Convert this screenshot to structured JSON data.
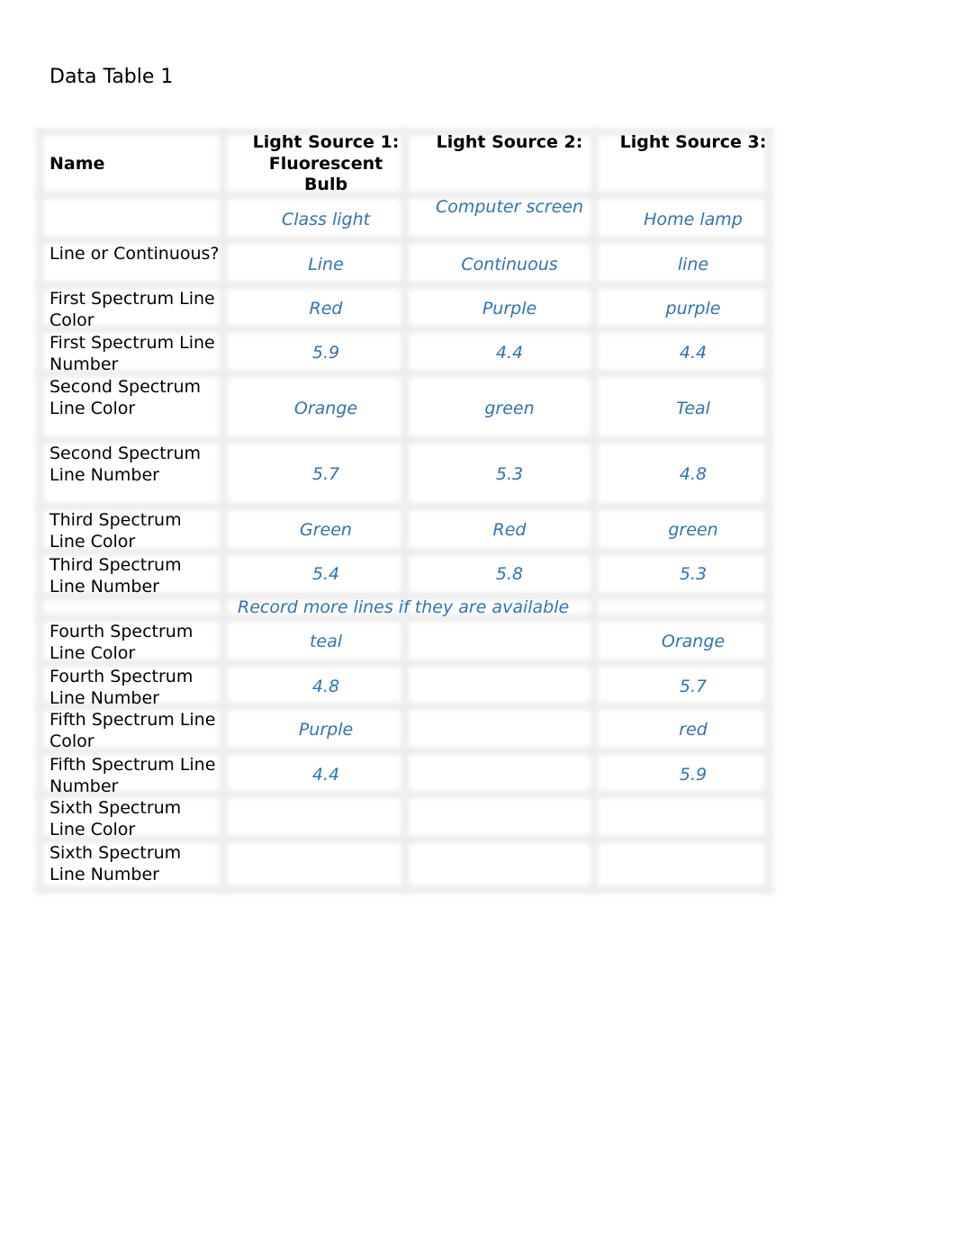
{
  "title": "Data Table 1",
  "table": {
    "headers": [
      "Name",
      "Light Source 1: Fluorescent Bulb",
      "Light Source 2:",
      "Light Source 3:"
    ],
    "header_lines": {
      "c1": [
        "Light Source 1:",
        "Fluorescent",
        "Bulb"
      ]
    },
    "rows": [
      {
        "label": "",
        "values": [
          "Class light",
          "Computer screen",
          "Home lamp"
        ]
      },
      {
        "label": "Line or Continuous?",
        "values": [
          "Line",
          "Continuous",
          "line"
        ]
      },
      {
        "label": "First Spectrum Line Color",
        "values": [
          "Red",
          "Purple",
          "purple"
        ]
      },
      {
        "label": "First Spectrum Line Number",
        "values": [
          "5.9",
          "4.4",
          "4.4"
        ]
      },
      {
        "label": "Second Spectrum Line Color",
        "values": [
          "Orange",
          "green",
          "Teal"
        ]
      },
      {
        "label": "Second Spectrum Line Number",
        "values": [
          "5.7",
          "5.3",
          "4.8"
        ]
      },
      {
        "label": "Third Spectrum Line Color",
        "values": [
          "Green",
          "Red",
          "green"
        ]
      },
      {
        "label": "Third Spectrum Line Number",
        "values": [
          "5.4",
          "5.8",
          "5.3"
        ]
      },
      {
        "label": "",
        "note": "Record more lines if they are available"
      },
      {
        "label": "Fourth Spectrum Line Color",
        "values": [
          "teal",
          "",
          "Orange"
        ]
      },
      {
        "label": "Fourth Spectrum Line Number",
        "values": [
          "4.8",
          "",
          "5.7"
        ]
      },
      {
        "label": "Fifth Spectrum Line Color",
        "values": [
          "Purple",
          "",
          "red"
        ]
      },
      {
        "label": "Fifth Spectrum Line Number",
        "values": [
          "4.4",
          "",
          "5.9"
        ]
      },
      {
        "label": "Sixth Spectrum Line Color",
        "values": [
          "",
          "",
          ""
        ]
      },
      {
        "label": "Sixth Spectrum Line Number",
        "values": [
          "",
          "",
          ""
        ]
      }
    ]
  },
  "colors": {
    "entry_text": "#2E74B5",
    "label_text": "#000000",
    "grid_line": "#ececec"
  }
}
